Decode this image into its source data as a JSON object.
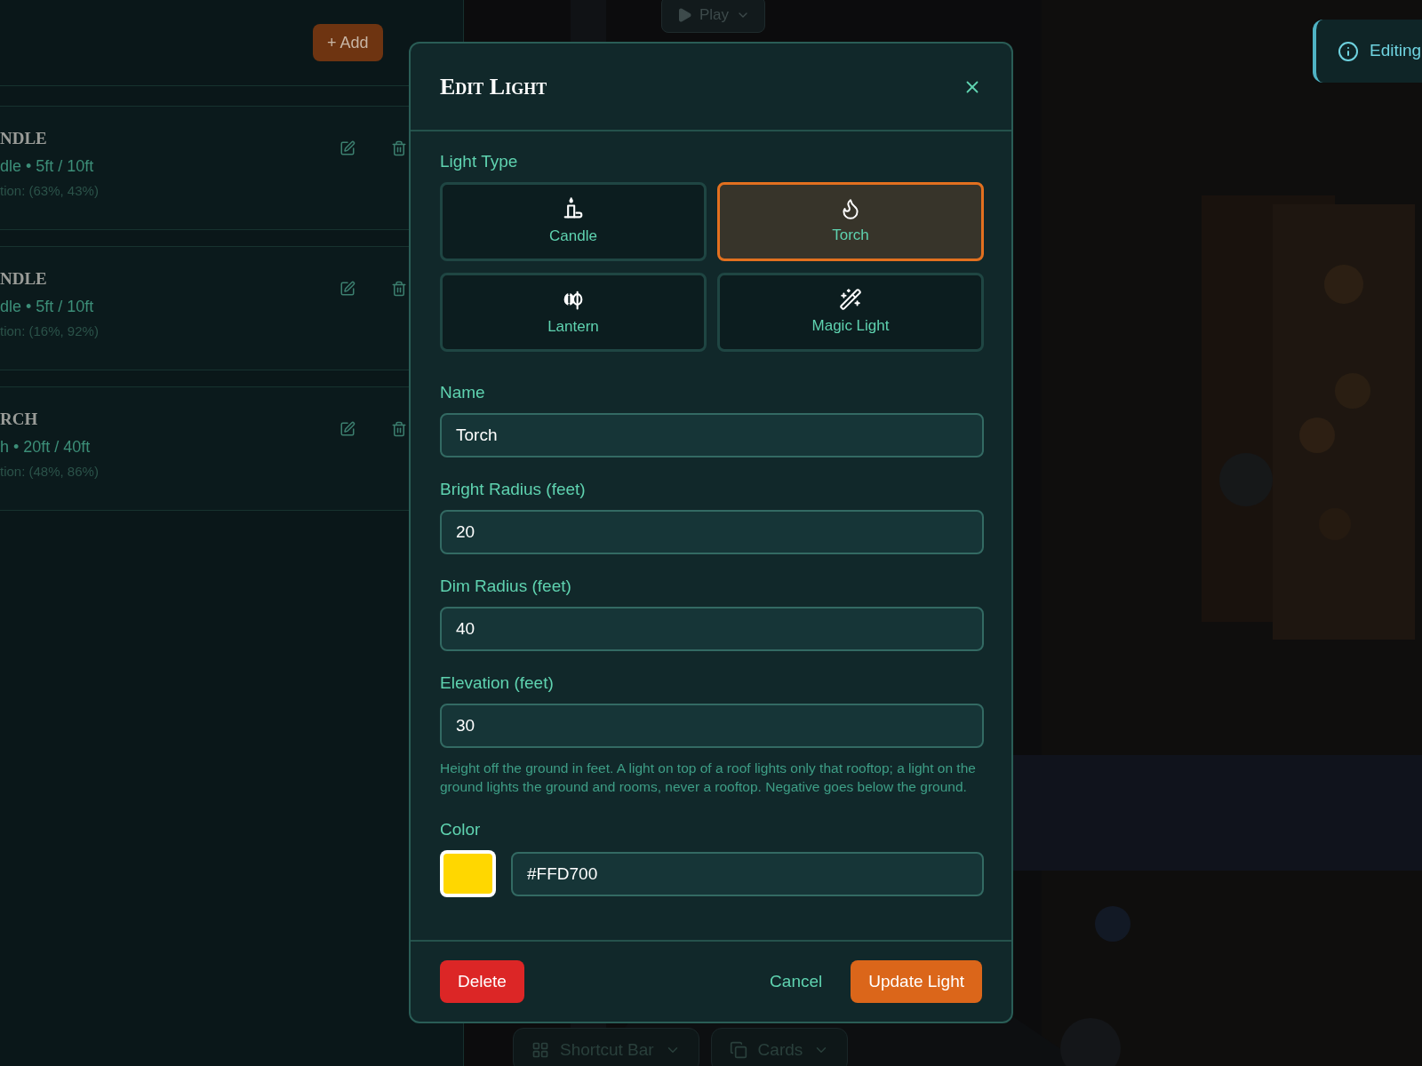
{
  "toolbar": {
    "play_button": "Play",
    "editing_banner": "Editing"
  },
  "lights_panel": {
    "add_button": "+ Add",
    "items": [
      {
        "title": "NDLE",
        "details": "dle • 5ft / 10ft",
        "position": "tion: (63%, 43%)"
      },
      {
        "title": "NDLE",
        "details": "dle • 5ft / 10ft",
        "position": "tion: (16%, 92%)"
      },
      {
        "title": "RCH",
        "details": "h • 20ft / 40ft",
        "position": "tion: (48%, 86%)"
      }
    ]
  },
  "dialog": {
    "title": "Edit Light",
    "light_type_label": "Light Type",
    "light_types": [
      {
        "kind": "candle",
        "label": "Candle",
        "selected": false
      },
      {
        "kind": "torch",
        "label": "Torch",
        "selected": true
      },
      {
        "kind": "lantern",
        "label": "Lantern",
        "selected": false
      },
      {
        "kind": "magic",
        "label": "Magic Light",
        "selected": false
      }
    ],
    "fields": [
      {
        "label": "Name",
        "value": "Torch"
      },
      {
        "label": "Bright Radius (feet)",
        "value": "20"
      },
      {
        "label": "Dim Radius (feet)",
        "value": "40"
      },
      {
        "label": "Elevation (feet)",
        "value": "30",
        "help": "Height off the ground in feet. A light on top of a roof lights only that rooftop; a light on the ground lights the ground and rooms, never a rooftop. Negative goes below the ground."
      }
    ],
    "color_label": "Color",
    "color": "#ffd700",
    "color_value": "#FFD700",
    "delete_button": "Delete",
    "cancel_button": "Cancel",
    "update_button": "Update Light"
  },
  "bottom_bar": {
    "shortcut_bar": "Shortcut Bar",
    "cards": "Cards"
  }
}
